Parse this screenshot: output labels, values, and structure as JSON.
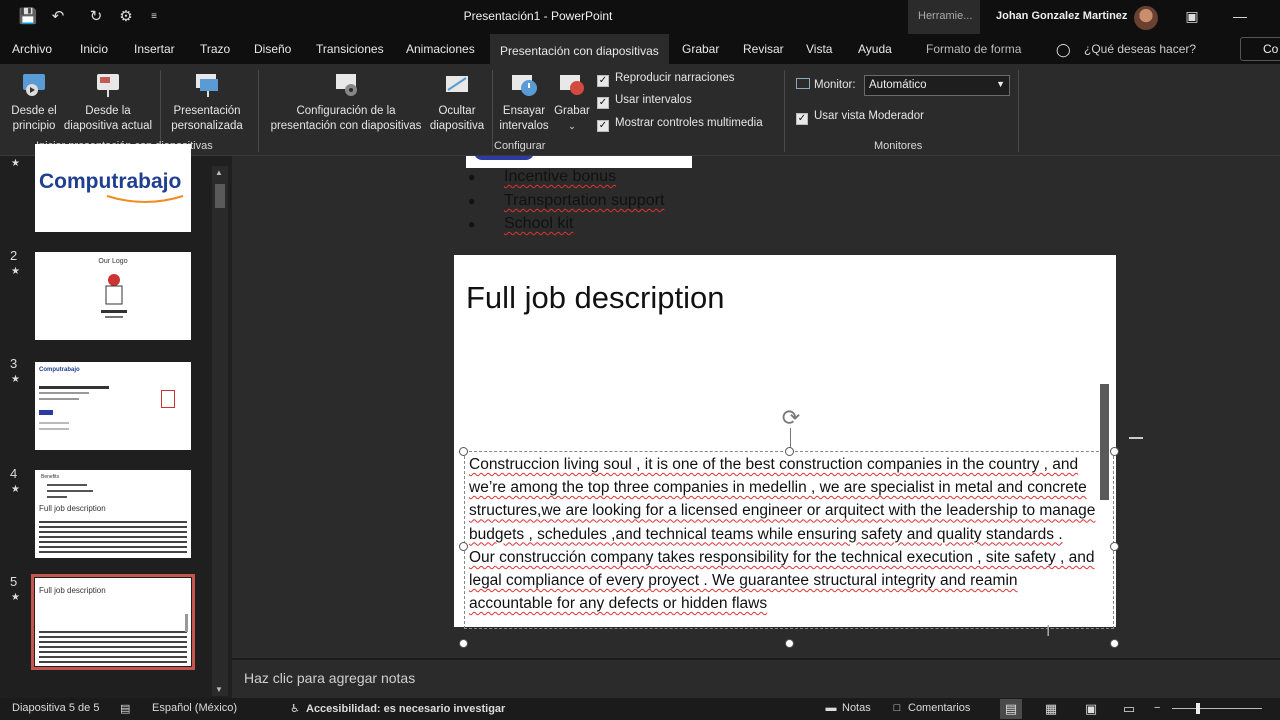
{
  "window": {
    "title": "Presentación1 - PowerPoint",
    "contextual_tab_group": "Herramie...",
    "user_name": "Johan Gonzalez Martinez"
  },
  "tabs": [
    {
      "label": "Archivo"
    },
    {
      "label": "Inicio"
    },
    {
      "label": "Insertar"
    },
    {
      "label": "Trazo"
    },
    {
      "label": "Diseño"
    },
    {
      "label": "Transiciones"
    },
    {
      "label": "Animaciones"
    },
    {
      "label": "Presentación con diapositivas",
      "active": true
    },
    {
      "label": "Grabar"
    },
    {
      "label": "Revisar"
    },
    {
      "label": "Vista"
    },
    {
      "label": "Ayuda"
    },
    {
      "label": "Formato de forma"
    }
  ],
  "tell_me": "¿Qué deseas hacer?",
  "ribbon": {
    "start": {
      "from_beginning": "Desde el principio",
      "from_current": "Desde la diapositiva actual",
      "custom": "Presentación personalizada",
      "group_label": "Iniciar presentación con diapositivas"
    },
    "setup": {
      "config": "Configuración de la presentación con diapositivas",
      "hide": "Ocultar diapositiva",
      "rehearse": "Ensayar intervalos",
      "record": "Grabar",
      "chk_narrations": "Reproducir narraciones",
      "chk_timings": "Usar intervalos",
      "chk_media": "Mostrar controles multimedia",
      "group_label": "Configurar"
    },
    "monitors": {
      "monitor_label": "Monitor:",
      "monitor_value": "Automático",
      "presenter_view": "Usar vista Moderador",
      "group_label": "Monitores"
    }
  },
  "thumbnails": [
    {
      "number": "",
      "content": "Computrabajo"
    },
    {
      "number": "2",
      "content": "Our Logo"
    },
    {
      "number": "3",
      "content": ""
    },
    {
      "number": "4",
      "content": ""
    },
    {
      "number": "5",
      "content": ""
    }
  ],
  "prev_slide_bullets": [
    "Incentive bonus",
    "Transportation support",
    "School kit"
  ],
  "slide": {
    "title": "Full job description",
    "body": "Construccion living soul , it is one of the best construction companies in the country , and we’re among the top three companies in medellin , we are specialist in metal and concrete structures,we are looking for a licensed engineer or arquitect with the leadership to manage budgets , schedules ,and technical teams while ensuring safety and quality standards .\nOur construcción company takes responsibility for the technical execution , site safety , and legal compliance of every proyect . We guarantee structural integrity and reamin accountable for any defects or hidden flaws"
  },
  "notes_placeholder": "Haz clic para agregar notas",
  "status": {
    "slide_counter": "Diapositiva 5 de 5",
    "language": "Español (México)",
    "accessibility": "Accesibilidad: es necesario investigar",
    "notes": "Notas",
    "comments": "Comentarios"
  },
  "colors": {
    "selected_thumb_border": "#c4564f",
    "background": "#1b1b1b",
    "ribbon": "#2b2b2b"
  }
}
